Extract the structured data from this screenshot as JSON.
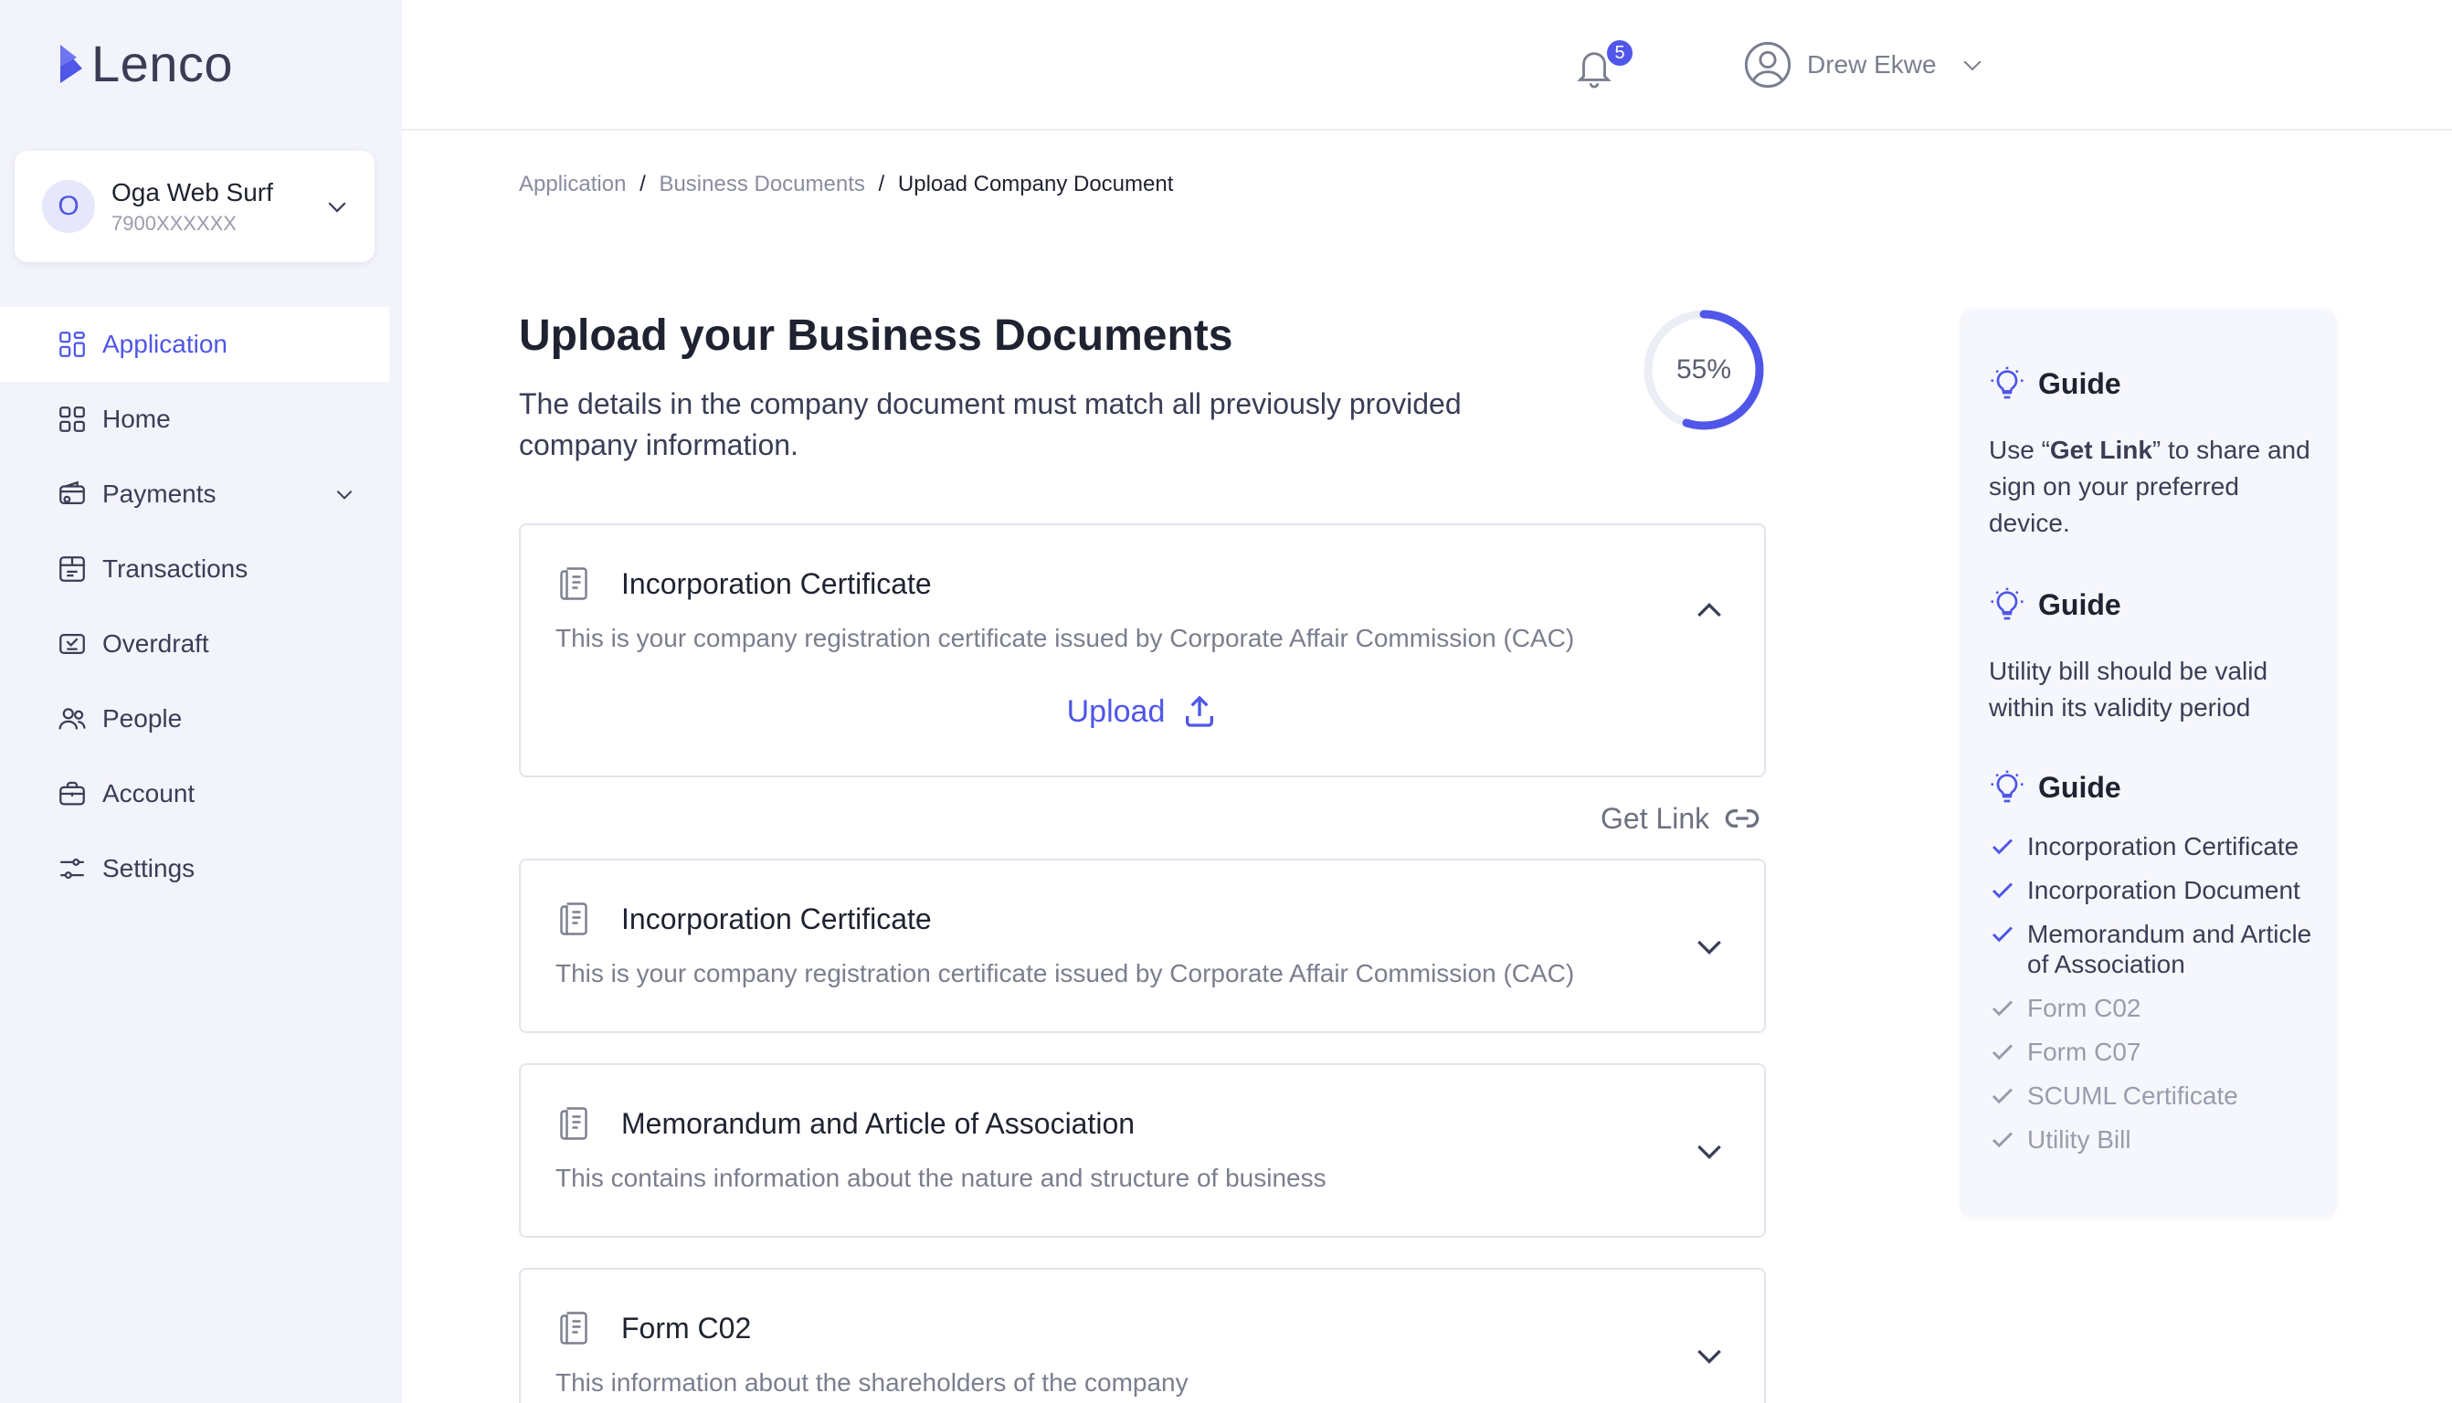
{
  "brand": {
    "name": "Lenco",
    "accent": "#4f56e8"
  },
  "company": {
    "initial": "O",
    "name": "Oga Web Surf",
    "account": "7900XXXXXX"
  },
  "nav": [
    {
      "label": "Application",
      "icon": "grid-icon",
      "active": true
    },
    {
      "label": "Home",
      "icon": "home-grid-icon"
    },
    {
      "label": "Payments",
      "icon": "wallet-icon",
      "expandable": true
    },
    {
      "label": "Transactions",
      "icon": "transactions-icon"
    },
    {
      "label": "Overdraft",
      "icon": "overdraft-icon"
    },
    {
      "label": "People",
      "icon": "people-icon"
    },
    {
      "label": "Account",
      "icon": "briefcase-icon"
    },
    {
      "label": "Settings",
      "icon": "settings-sliders-icon"
    }
  ],
  "header": {
    "notification_count": "5",
    "user_name": "Drew Ekwe"
  },
  "breadcrumb": {
    "item1": "Application",
    "item2": "Business Documents",
    "current": "Upload Company Document",
    "separator": "/"
  },
  "page": {
    "title": "Upload your Business Documents",
    "description": "The details in the company document must match all previously provided company information.",
    "progress_label": "55%",
    "progress_value": 0.55
  },
  "documents": [
    {
      "title": "Incorporation Certificate",
      "description": "This is your company registration certificate issued by Corporate Affair Commission (CAC)",
      "expanded": true,
      "upload_label": "Upload"
    },
    {
      "title": "Incorporation Certificate",
      "description": "This is your company registration certificate issued by Corporate Affair Commission (CAC)",
      "expanded": false
    },
    {
      "title": "Memorandum and Article of Association",
      "description": "This contains information about the nature and structure of business",
      "expanded": false
    },
    {
      "title": "Form C02",
      "description": "This information about the shareholders of the company",
      "expanded": false
    }
  ],
  "get_link_label": "Get Link",
  "guide": {
    "heading": "Guide",
    "tip1_pre": "Use “",
    "tip1_bold": "Get Link",
    "tip1_post": "” to share and sign on your preferred device.",
    "tip2": "Utility bill should be valid within its validity period",
    "checklist": [
      {
        "label": "Incorporation Certificate",
        "done": true
      },
      {
        "label": "Incorporation Document",
        "done": true
      },
      {
        "label": "Memorandum and Article of Association",
        "done": true
      },
      {
        "label": "Form C02",
        "done": false
      },
      {
        "label": "Form C07",
        "done": false
      },
      {
        "label": "SCUML Certificate",
        "done": false
      },
      {
        "label": "Utility Bill",
        "done": false
      }
    ]
  }
}
